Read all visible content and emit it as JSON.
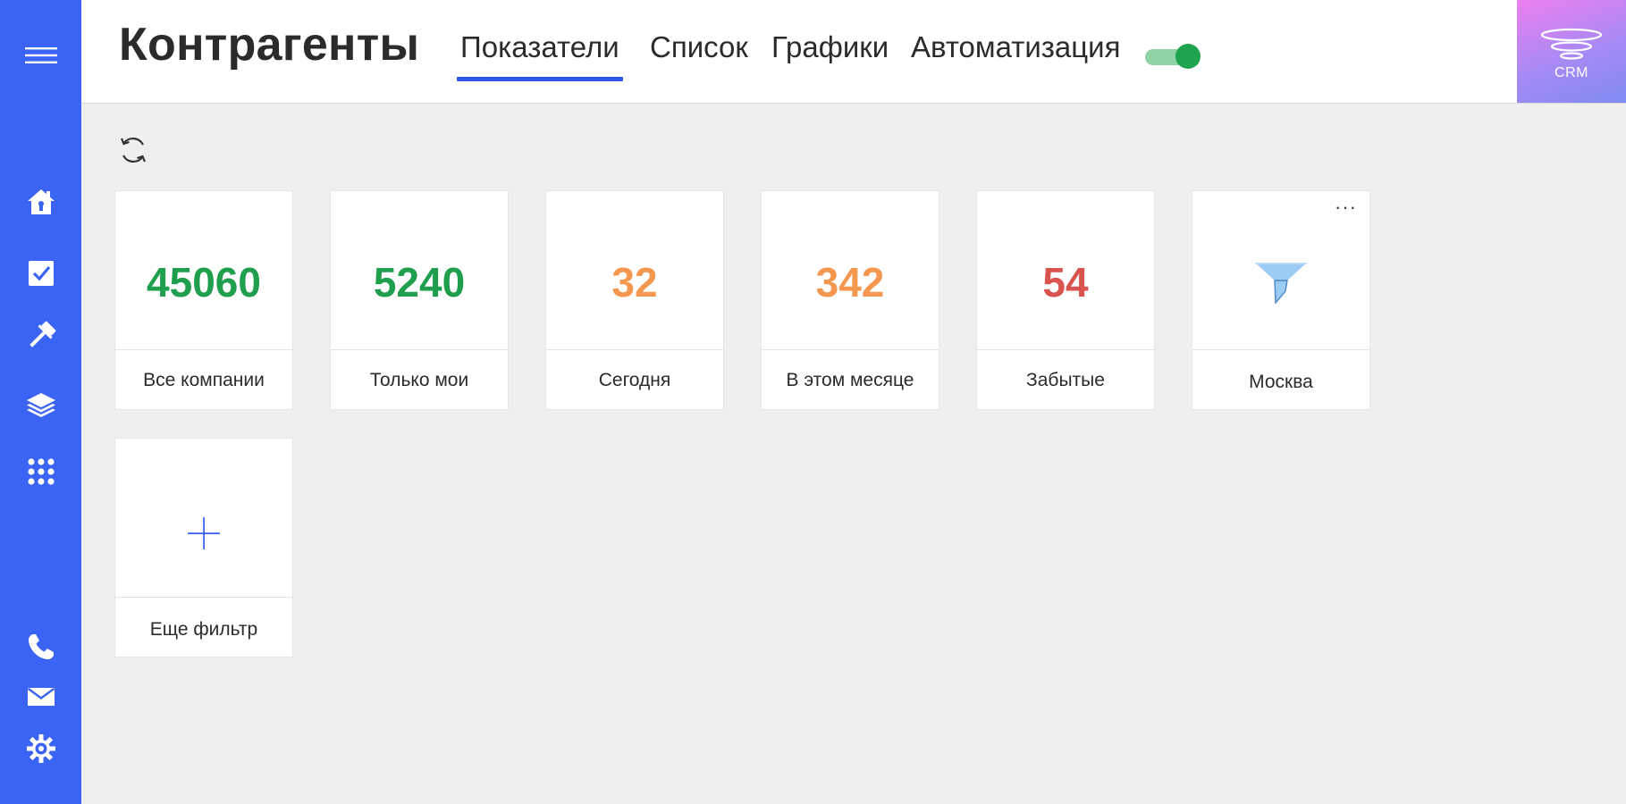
{
  "header": {
    "title": "Контрагенты",
    "tabs": [
      {
        "label": "Показатели",
        "active": true
      },
      {
        "label": "Список",
        "active": false
      },
      {
        "label": "Графики",
        "active": false
      },
      {
        "label": "Автоматизация",
        "active": false
      }
    ],
    "toggle_on": true,
    "logo_text": "CRM"
  },
  "sidebar": {
    "items": [
      {
        "icon": "menu-icon"
      },
      {
        "icon": "home-icon"
      },
      {
        "icon": "tasks-icon"
      },
      {
        "icon": "gavel-icon"
      },
      {
        "icon": "layers-icon"
      },
      {
        "icon": "apps-grid-icon"
      },
      {
        "icon": "phone-icon"
      },
      {
        "icon": "mail-icon"
      },
      {
        "icon": "settings-gear-icon"
      }
    ]
  },
  "cards": [
    {
      "value": "45060",
      "label": "Все компании",
      "color": "#1f9e4d"
    },
    {
      "value": "5240",
      "label": "Только мои",
      "color": "#1f9e4d"
    },
    {
      "value": "32",
      "label": "Сегодня",
      "color": "#f5974f"
    },
    {
      "value": "342",
      "label": "В этом месяце",
      "color": "#f5974f"
    },
    {
      "value": "54",
      "label": "Забытые",
      "color": "#d9534f"
    },
    {
      "value": "",
      "label": "Москва",
      "icon": "filter-funnel-icon",
      "menu": "···"
    }
  ],
  "add_card": {
    "label": "Еще фильтр",
    "icon": "plus-icon"
  },
  "colors": {
    "sidebar": "#3b63f4",
    "accent": "#2f57e6",
    "toggle": "#20a450"
  }
}
